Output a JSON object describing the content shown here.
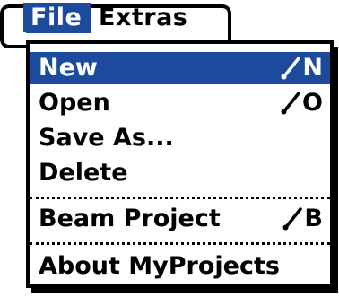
{
  "menubar": {
    "titles": [
      {
        "label": "File"
      },
      {
        "label": "Extras"
      }
    ]
  },
  "menu": {
    "items": [
      {
        "label": "New",
        "shortcut": "N"
      },
      {
        "label": "Open",
        "shortcut": "O"
      },
      {
        "label": "Save As..."
      },
      {
        "label": "Delete"
      },
      {
        "label": "Beam Project",
        "shortcut": "B"
      },
      {
        "label": "About MyProjects"
      }
    ]
  },
  "colors": {
    "highlight": "#1c4a9c",
    "highlight_text": "#ffffff",
    "text": "#000000",
    "background": "#ffffff"
  },
  "icons": {
    "shortcut_prefix": "command-stroke-icon"
  }
}
